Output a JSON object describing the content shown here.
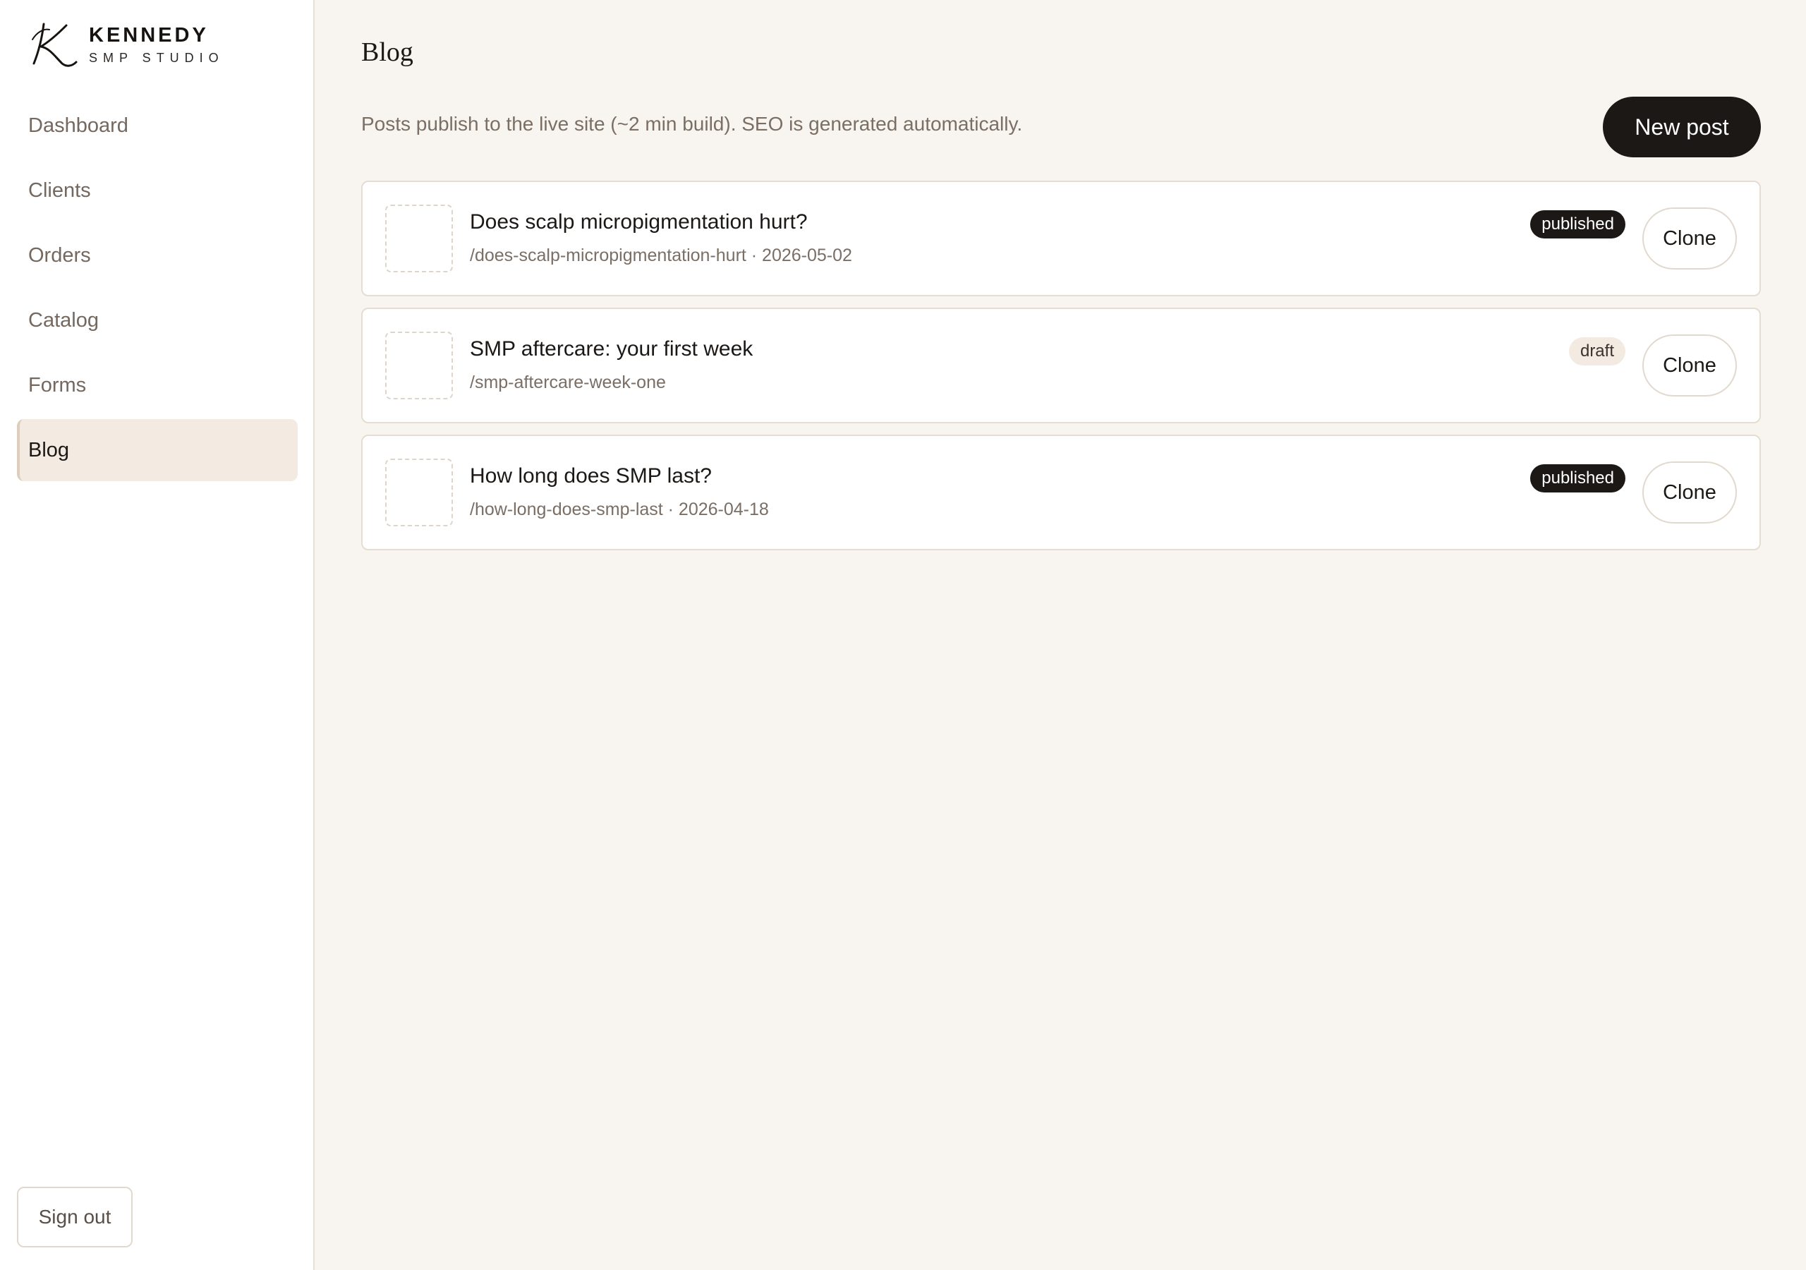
{
  "brand": {
    "name": "KENNEDY",
    "sub": "SMP STUDIO",
    "logo_icon": "k-monogram-icon"
  },
  "nav": {
    "items": [
      {
        "label": "Dashboard",
        "active": false
      },
      {
        "label": "Clients",
        "active": false
      },
      {
        "label": "Orders",
        "active": false
      },
      {
        "label": "Catalog",
        "active": false
      },
      {
        "label": "Forms",
        "active": false
      },
      {
        "label": "Blog",
        "active": true
      }
    ],
    "signout_label": "Sign out"
  },
  "header": {
    "title": "Blog",
    "subtitle": "Posts publish to the live site (~2 min build). SEO is generated automatically.",
    "new_post_label": "New post"
  },
  "posts": [
    {
      "title": "Does scalp micropigmentation hurt?",
      "meta": "/does-scalp-micropigmentation-hurt · 2026-05-02",
      "status": "published",
      "clone_label": "Clone"
    },
    {
      "title": "SMP aftercare: your first week",
      "meta": "/smp-aftercare-week-one",
      "status": "draft",
      "clone_label": "Clone"
    },
    {
      "title": "How long does SMP last?",
      "meta": "/how-long-does-smp-last · 2026-04-18",
      "status": "published",
      "clone_label": "Clone"
    }
  ],
  "colors": {
    "background": "#f8f5f0",
    "sidebar": "#ffffff",
    "accent_dark": "#1b1816",
    "active_nav": "#f3ebe2",
    "border": "#e5ddd2"
  }
}
